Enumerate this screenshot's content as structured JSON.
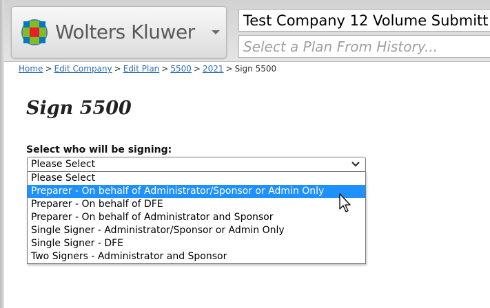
{
  "header": {
    "brand": "Wolters Kluwer",
    "company_value": "Test Company 12 Volume Submitt",
    "plan_placeholder": "Select a Plan From History..."
  },
  "breadcrumb": {
    "items": [
      "Home",
      "Edit Company",
      "Edit Plan",
      "5500",
      "2021"
    ],
    "current": "Sign 5500",
    "separator": ">"
  },
  "page": {
    "title": "Sign 5500",
    "signer_label": "Select who will be signing:",
    "select_value": "Please Select"
  },
  "dropdown": {
    "options": [
      "Please Select",
      "Preparer - On behalf of Administrator/Sponsor or Admin Only",
      "Preparer - On behalf of DFE",
      "Preparer - On behalf of Administrator and Sponsor",
      "Single Signer - Administrator/Sponsor or Admin Only",
      "Single Signer - DFE",
      "Two Signers - Administrator and Sponsor"
    ],
    "highlighted_index": 1
  },
  "colors": {
    "link": "#2f6db5",
    "highlight": "#1e90ff",
    "logo_green": "#85bc20",
    "logo_blue": "#007ac3",
    "logo_red": "#e5202e"
  }
}
